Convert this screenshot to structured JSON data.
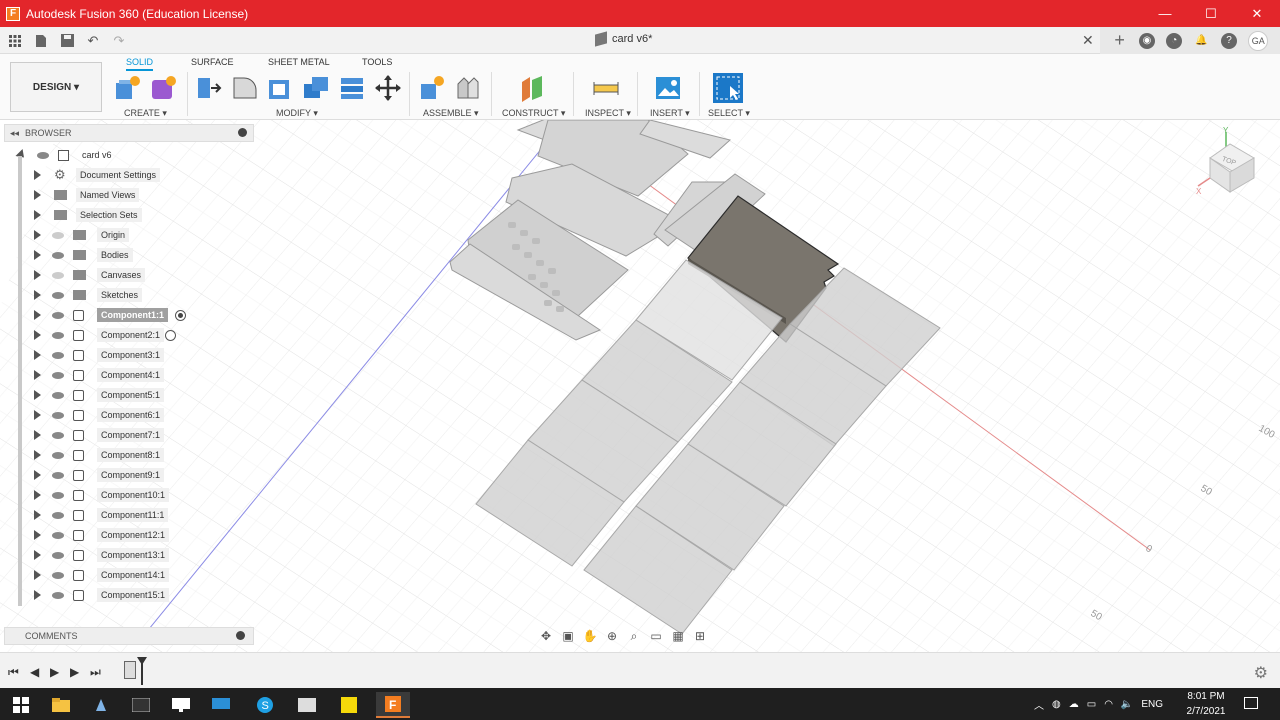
{
  "window": {
    "title": "Autodesk Fusion 360 (Education License)",
    "logo_letter": "F",
    "minimize": "—",
    "maximize": "☐",
    "close": "✕"
  },
  "tabbar": {
    "doc_title": "card v6*",
    "close_symbol": "✕",
    "user_initials": "GA"
  },
  "toolbar": {
    "workspace": "DESIGN ▾",
    "tabs": [
      "SOLID",
      "SURFACE",
      "SHEET METAL",
      "TOOLS"
    ],
    "active_tab": "SOLID",
    "groups": {
      "create": "CREATE ▾",
      "modify": "MODIFY ▾",
      "assemble": "ASSEMBLE ▾",
      "construct": "CONSTRUCT ▾",
      "inspect": "INSPECT ▾",
      "insert": "INSERT ▾",
      "select": "SELECT ▾"
    }
  },
  "browser": {
    "header": "BROWSER",
    "root": "card v6",
    "items": [
      {
        "label": "Document Settings",
        "kind": "gear"
      },
      {
        "label": "Named Views",
        "kind": "folder"
      },
      {
        "label": "Selection Sets",
        "kind": "folder"
      },
      {
        "label": "Origin",
        "kind": "folder",
        "eye": "dim"
      },
      {
        "label": "Bodies",
        "kind": "folder",
        "eye": "on"
      },
      {
        "label": "Canvases",
        "kind": "folder",
        "eye": "dim"
      },
      {
        "label": "Sketches",
        "kind": "folder",
        "eye": "on"
      },
      {
        "label": "Component1:1",
        "kind": "comp",
        "eye": "on",
        "selected": true,
        "radio": "on"
      },
      {
        "label": "Component2:1",
        "kind": "comp",
        "eye": "on",
        "radio": "off"
      },
      {
        "label": "Component3:1",
        "kind": "comp",
        "eye": "on"
      },
      {
        "label": "Component4:1",
        "kind": "comp",
        "eye": "on"
      },
      {
        "label": "Component5:1",
        "kind": "comp",
        "eye": "on"
      },
      {
        "label": "Component6:1",
        "kind": "comp",
        "eye": "on"
      },
      {
        "label": "Component7:1",
        "kind": "comp",
        "eye": "on"
      },
      {
        "label": "Component8:1",
        "kind": "comp",
        "eye": "on"
      },
      {
        "label": "Component9:1",
        "kind": "comp",
        "eye": "on"
      },
      {
        "label": "Component10:1",
        "kind": "comp",
        "eye": "on"
      },
      {
        "label": "Component11:1",
        "kind": "comp",
        "eye": "on"
      },
      {
        "label": "Component12:1",
        "kind": "comp",
        "eye": "on"
      },
      {
        "label": "Component13:1",
        "kind": "comp",
        "eye": "on"
      },
      {
        "label": "Component14:1",
        "kind": "comp",
        "eye": "on"
      },
      {
        "label": "Component15:1",
        "kind": "comp",
        "eye": "on"
      }
    ]
  },
  "comments": {
    "label": "COMMENTS"
  },
  "viewcube": {
    "face": "TOP",
    "axis_x": "X",
    "axis_y": "Y"
  },
  "grid_labels": [
    "100",
    "50",
    "0",
    "50"
  ],
  "taskbar": {
    "language": "ENG",
    "time": "8:01 PM",
    "date": "2/7/2021"
  },
  "colors": {
    "title_red": "#e3262b",
    "accent_blue": "#0696d7",
    "selected_part": "#7a756d",
    "part_fill": "#cfcfcf"
  }
}
